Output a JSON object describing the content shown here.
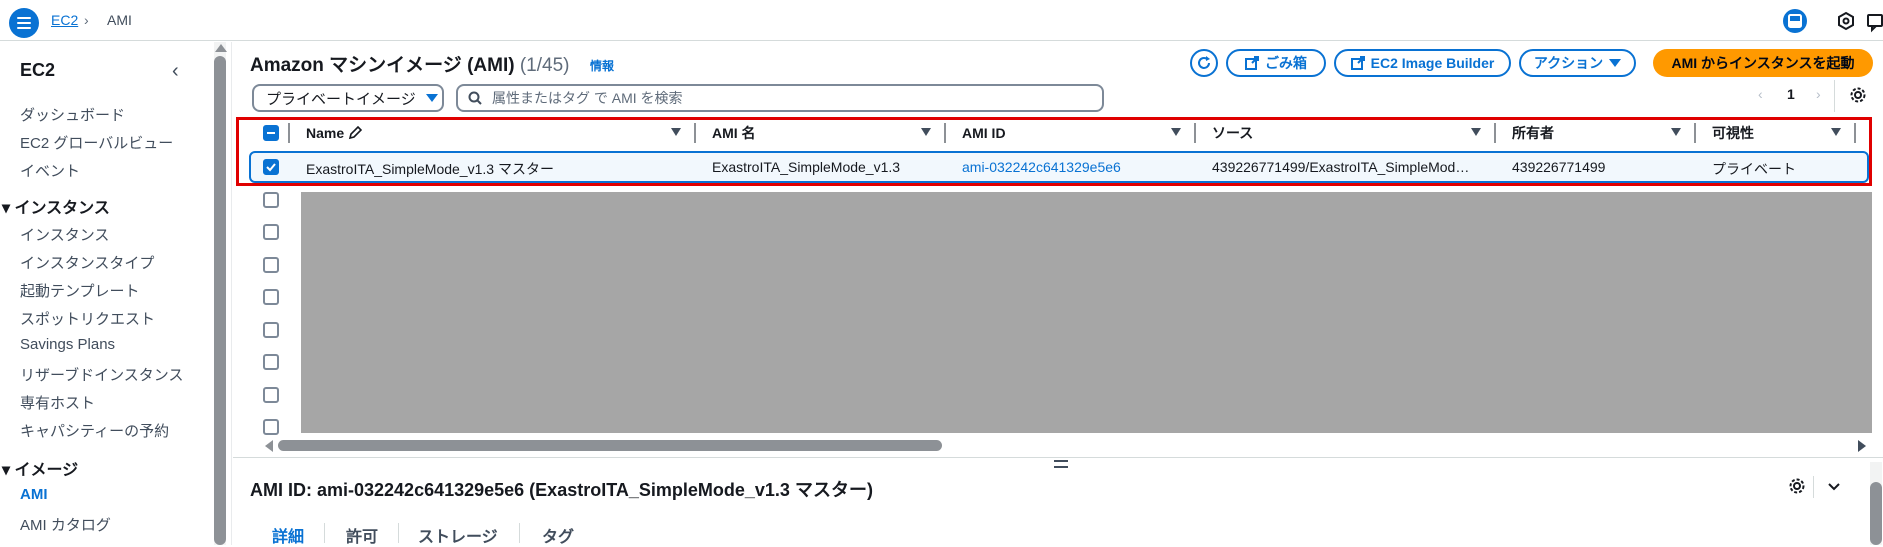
{
  "breadcrumb": {
    "parent": "EC2",
    "current": "AMI"
  },
  "sidebar": {
    "title": "EC2",
    "top_items": [
      "ダッシュボード",
      "EC2 グローバルビュー",
      "イベント"
    ],
    "sections": [
      {
        "label": "インスタンス",
        "items": [
          "インスタンス",
          "インスタンスタイプ",
          "起動テンプレート",
          "スポットリクエスト",
          "Savings Plans",
          "リザーブドインスタンス",
          "専有ホスト",
          "キャパシティーの予約"
        ]
      },
      {
        "label": "イメージ",
        "items": [
          "AMI",
          "AMI カタログ"
        ]
      }
    ],
    "active_item": "AMI"
  },
  "header": {
    "title": "Amazon マシンイメージ (AMI)",
    "count": "(1/45)",
    "info": "情報",
    "recycle_bin": "ごみ箱",
    "image_builder": "EC2 Image Builder",
    "actions": "アクション",
    "launch": "AMI からインスタンスを起動"
  },
  "filter": {
    "selected": "プライベートイメージ",
    "search_placeholder": "属性またはタグ で AMI を検索"
  },
  "pagination": {
    "page": "1"
  },
  "table": {
    "columns": [
      "Name",
      "AMI 名",
      "AMI ID",
      "ソース",
      "所有者",
      "可視性"
    ],
    "rows": [
      {
        "name": "ExastroITA_SimpleMode_v1.3 マスター",
        "ami_name": "ExastroITA_SimpleMode_v1.3",
        "ami_id": "ami-032242c641329e5e6",
        "source": "439226771499/ExastroITA_SimpleMod…",
        "owner": "439226771499",
        "visibility": "プライベート",
        "selected": true
      }
    ]
  },
  "detail": {
    "title": "AMI ID: ami-032242c641329e5e6 (ExastroITA_SimpleMode_v1.3 マスター)",
    "tabs": [
      "詳細",
      "許可",
      "ストレージ",
      "タグ"
    ],
    "active_tab": "詳細"
  },
  "colors": {
    "accent": "#0972d3",
    "primary_button": "#ff9900",
    "highlight": "#e00000",
    "redacted": "#a6a6a6"
  }
}
